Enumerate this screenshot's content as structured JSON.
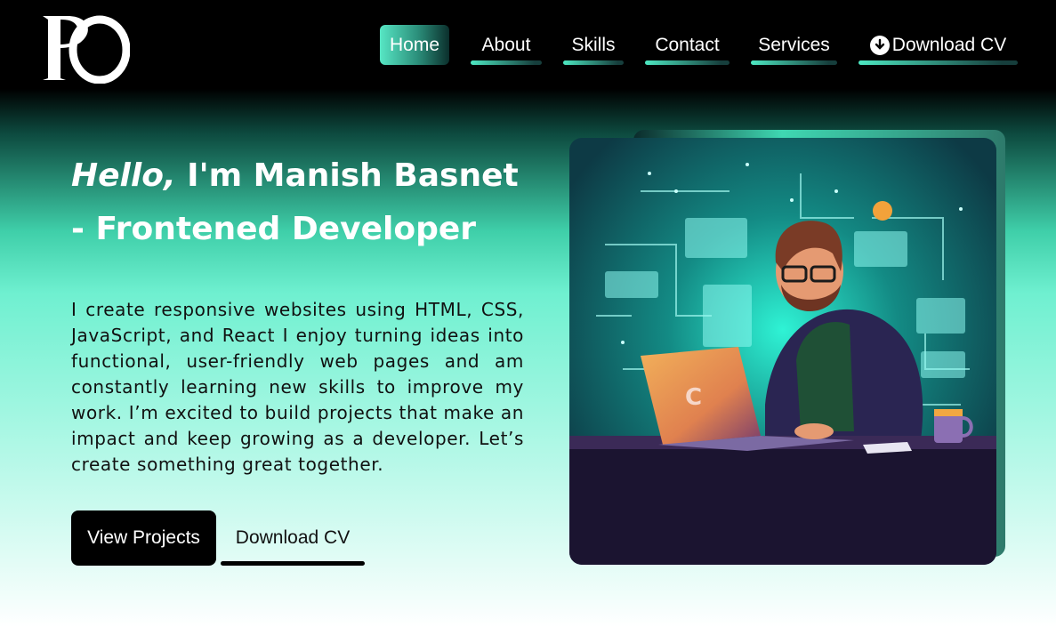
{
  "logo": {
    "icon": "po-monogram-logo"
  },
  "nav": {
    "items": [
      {
        "label": "Home",
        "active": true
      },
      {
        "label": "About"
      },
      {
        "label": "Skills"
      },
      {
        "label": "Contact"
      },
      {
        "label": "Services"
      }
    ],
    "download": {
      "label": "Download CV",
      "icon": "download-circle-icon"
    }
  },
  "hero": {
    "hello": "Hello,",
    "title_rest": " I'm Manish Basnet - Frontened Developer",
    "description": "I create responsive websites using HTML, CSS, JavaScript, and React I enjoy turning ideas into functional, user-friendly web pages and am constantly learning new skills to improve my work. I’m excited to build projects that make an impact and keep growing as a developer. Let’s create something great together.",
    "primary_button": "View Projects",
    "secondary_button": "Download CV",
    "illustration": "developer-at-laptop-illustration"
  },
  "colors": {
    "accent": "#4de8c2",
    "header_bg": "#000000",
    "button_bg": "#000000"
  }
}
